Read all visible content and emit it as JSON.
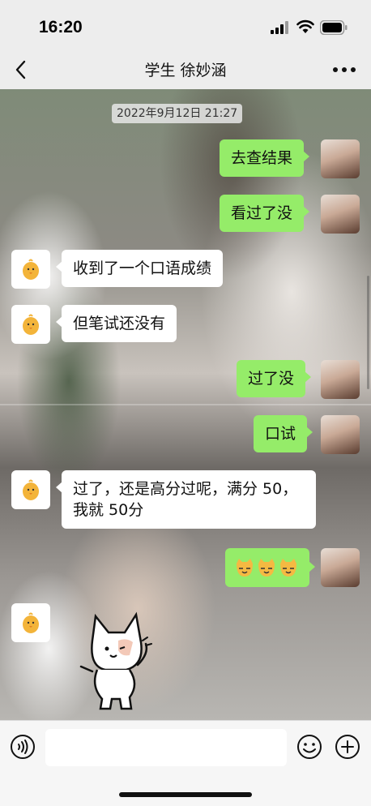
{
  "status_bar": {
    "time": "16:20",
    "icons": [
      "signal-icon",
      "wifi-icon",
      "battery-icon"
    ]
  },
  "header": {
    "title": "学生 徐妙涵",
    "back_icon": "chevron-left-icon",
    "more_icon": "more-dots-icon"
  },
  "chat": {
    "timestamp": "2022年9月12日 21:27",
    "messages": [
      {
        "sender": "me",
        "text": "去查结果"
      },
      {
        "sender": "me",
        "text": "看过了没"
      },
      {
        "sender": "other",
        "text": "收到了一个口语成绩"
      },
      {
        "sender": "other",
        "text": "但笔试还没有"
      },
      {
        "sender": "me",
        "text": "过了没"
      },
      {
        "sender": "me",
        "text": "口试"
      },
      {
        "sender": "other",
        "text": "过了，还是高分过呢，满分 50，我就 50分"
      },
      {
        "sender": "me",
        "sticker": "three-cat-face-emoji-sticker"
      },
      {
        "sender": "other",
        "sticker": "waving-cat-sticker"
      }
    ]
  },
  "input_bar": {
    "voice_icon": "voice-icon",
    "input_value": "",
    "emoji_icon": "emoji-icon",
    "plus_icon": "plus-icon"
  },
  "colors": {
    "bubble_me": "#95ec69",
    "bubble_other": "#ffffff",
    "bar_bg": "#ededed"
  }
}
